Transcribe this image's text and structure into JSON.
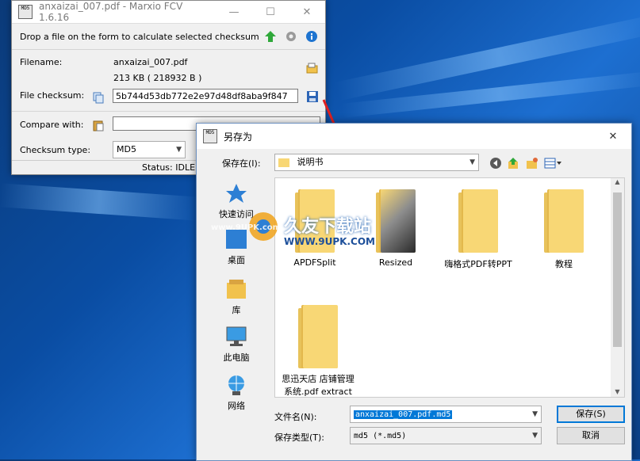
{
  "fcv": {
    "title": "anxaizai_007.pdf - Marxio FCV 1.6.16",
    "app_icon_text": "MD5",
    "hint": "Drop a file on the form to calculate selected checksum",
    "filename_label": "Filename:",
    "filename_value": "anxaizai_007.pdf",
    "size_value": "213 KB ( 218932 B )",
    "checksum_label": "File checksum:",
    "checksum_value": "5b744d53db772e2e97d48df8aba9f847",
    "compare_label": "Compare with:",
    "compare_value": "",
    "type_label": "Checksum type:",
    "type_value": "MD5",
    "status": "Status: IDLE"
  },
  "dialog": {
    "title": "另存为",
    "app_icon_text": "MD5",
    "save_in_label": "保存在(I):",
    "save_in_value": "说明书",
    "places": [
      {
        "label": "快速访问"
      },
      {
        "label": "桌面"
      },
      {
        "label": "库"
      },
      {
        "label": "此电脑"
      },
      {
        "label": "网络"
      }
    ],
    "items": [
      {
        "label": "APDFSplit"
      },
      {
        "label": "Resized"
      },
      {
        "label": "嗨格式PDF转PPT"
      },
      {
        "label": "教程"
      },
      {
        "label": "思迅天店 店铺管理系统.pdf extract"
      }
    ],
    "filename_label": "文件名(N):",
    "filename_value": "anxaizai_007.pdf.md5",
    "filetype_label": "保存类型(T):",
    "filetype_value": "md5 (*.md5)",
    "save_button": "保存(S)",
    "cancel_button": "取消"
  },
  "watermark": {
    "brand": "久友下载站",
    "url_left": "www.9UPK.com",
    "url_right": "WWW.9UPK.COM"
  },
  "colors": {
    "accent": "#0078d7",
    "folder": "#f8d775",
    "arrow": "#e02020"
  }
}
